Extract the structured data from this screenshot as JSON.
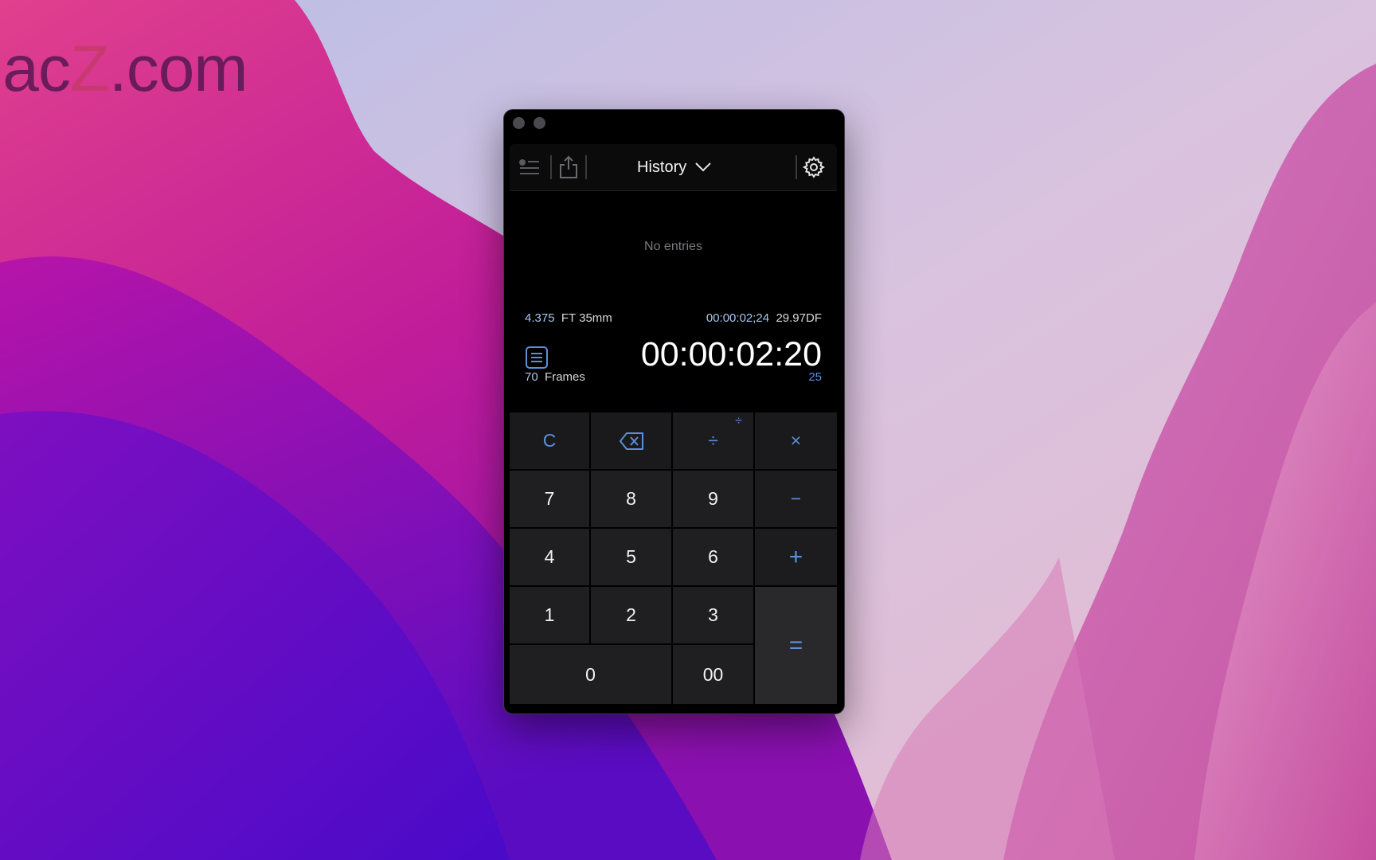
{
  "watermark": {
    "text_a": "lac",
    "text_z": "Z",
    "text_b": ".com"
  },
  "toolbar": {
    "title": "History",
    "icons": [
      "list-icon",
      "share-icon",
      "chevron-down-icon",
      "gear-icon"
    ]
  },
  "history": {
    "empty_text": "No entries"
  },
  "display": {
    "feet_value": "4.375",
    "feet_unit": "FT 35mm",
    "secondary_timecode": "00:00:02;24",
    "secondary_rate": "29.97DF",
    "main_timecode": "00:00:02:20",
    "frames_value": "70",
    "frames_unit": "Frames",
    "fps": "25"
  },
  "keypad": {
    "clear": "C",
    "divide": "÷",
    "divide_alt": "÷",
    "multiply": "×",
    "minus": "−",
    "plus": "+",
    "equals": "=",
    "k7": "7",
    "k8": "8",
    "k9": "9",
    "k4": "4",
    "k5": "5",
    "k6": "6",
    "k1": "1",
    "k2": "2",
    "k3": "3",
    "k0": "0",
    "k00": "00"
  },
  "colors": {
    "accent": "#5d8fd8",
    "key_bg": "#1f1f21",
    "window_bg": "#000000"
  }
}
